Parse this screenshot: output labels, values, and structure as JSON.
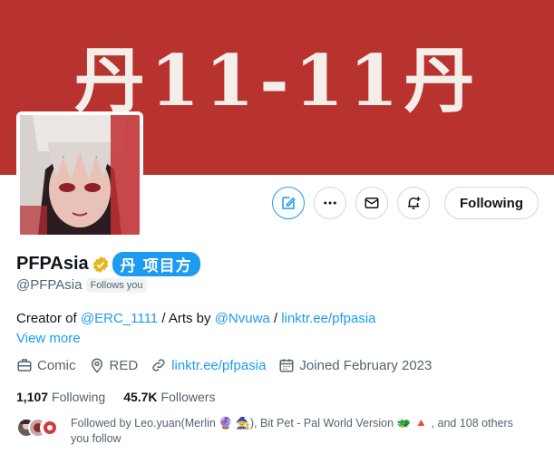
{
  "banner": {
    "text": "丹11-11丹",
    "background_color": "#b83230"
  },
  "avatar": {
    "description_icon": "anime-girl-avatar"
  },
  "actions": {
    "edit_icon": "edit-note-icon",
    "more_icon": "more-horizontal-icon",
    "message_icon": "envelope-icon",
    "notify_icon": "bell-plus-icon",
    "following_label": "Following"
  },
  "profile": {
    "display_name": "PFPAsia",
    "verified_icon": "gold-verified-badge-icon",
    "name_tag": "丹 项目方",
    "handle": "@PFPAsia",
    "follows_you": "Follows you"
  },
  "bio": {
    "prefix": "Creator of ",
    "mention1": "@ERC_1111",
    "middle": " / Arts by ",
    "mention2": "@Nvuwa",
    "sep": " / ",
    "link": "linktr.ee/pfpasia",
    "view_more": "View more"
  },
  "meta": {
    "category": "Comic",
    "location": "RED",
    "website": "linktr.ee/pfpasia",
    "joined": "Joined February 2023"
  },
  "stats": {
    "following_count": "1,107",
    "following_label": "Following",
    "followers_count": "45.7K",
    "followers_label": "Followers"
  },
  "followed_by": {
    "text_line1": "Followed by Leo.yuan(Merlin 🔮 🧙), Bit Pet - Pal World Version 🐲 🔺 , and 108 others",
    "text_line2": "you follow"
  },
  "colors": {
    "accent": "#1d9bf0",
    "muted": "#536471",
    "text": "#0f1419"
  }
}
